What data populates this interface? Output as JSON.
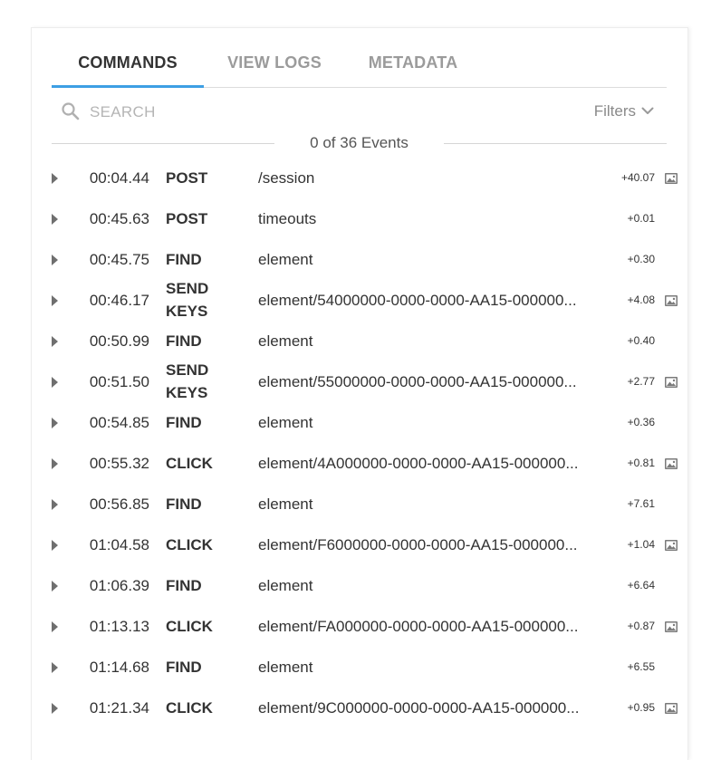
{
  "tabs": [
    {
      "label": "COMMANDS",
      "active": true
    },
    {
      "label": "VIEW LOGS",
      "active": false
    },
    {
      "label": "METADATA",
      "active": false
    }
  ],
  "search": {
    "placeholder": "SEARCH",
    "value": "",
    "icon": "search-icon"
  },
  "filters": {
    "label": "Filters",
    "icon": "chevron-down-icon"
  },
  "events_count": "0 of 36 Events",
  "colors": {
    "accent": "#3d9fe4",
    "text": "#333333",
    "muted": "#9b9b9b"
  },
  "commands": [
    {
      "time": "00:04.44",
      "method": "POST",
      "path": "/session",
      "delta": "+40.07",
      "screenshot": true
    },
    {
      "time": "00:45.63",
      "method": "POST",
      "path": "timeouts",
      "delta": "+0.01",
      "screenshot": false
    },
    {
      "time": "00:45.75",
      "method": "FIND",
      "path": "element",
      "delta": "+0.30",
      "screenshot": false
    },
    {
      "time": "00:46.17",
      "method": "SEND KEYS",
      "path": "element/54000000-0000-0000-AA15-000000...",
      "delta": "+4.08",
      "screenshot": true
    },
    {
      "time": "00:50.99",
      "method": "FIND",
      "path": "element",
      "delta": "+0.40",
      "screenshot": false
    },
    {
      "time": "00:51.50",
      "method": "SEND KEYS",
      "path": "element/55000000-0000-0000-AA15-000000...",
      "delta": "+2.77",
      "screenshot": true
    },
    {
      "time": "00:54.85",
      "method": "FIND",
      "path": "element",
      "delta": "+0.36",
      "screenshot": false
    },
    {
      "time": "00:55.32",
      "method": "CLICK",
      "path": "element/4A000000-0000-0000-AA15-000000...",
      "delta": "+0.81",
      "screenshot": true
    },
    {
      "time": "00:56.85",
      "method": "FIND",
      "path": "element",
      "delta": "+7.61",
      "screenshot": false
    },
    {
      "time": "01:04.58",
      "method": "CLICK",
      "path": "element/F6000000-0000-0000-AA15-000000...",
      "delta": "+1.04",
      "screenshot": true
    },
    {
      "time": "01:06.39",
      "method": "FIND",
      "path": "element",
      "delta": "+6.64",
      "screenshot": false
    },
    {
      "time": "01:13.13",
      "method": "CLICK",
      "path": "element/FA000000-0000-0000-AA15-000000...",
      "delta": "+0.87",
      "screenshot": true
    },
    {
      "time": "01:14.68",
      "method": "FIND",
      "path": "element",
      "delta": "+6.55",
      "screenshot": false
    },
    {
      "time": "01:21.34",
      "method": "CLICK",
      "path": "element/9C000000-0000-0000-AA15-000000...",
      "delta": "+0.95",
      "screenshot": true
    }
  ]
}
